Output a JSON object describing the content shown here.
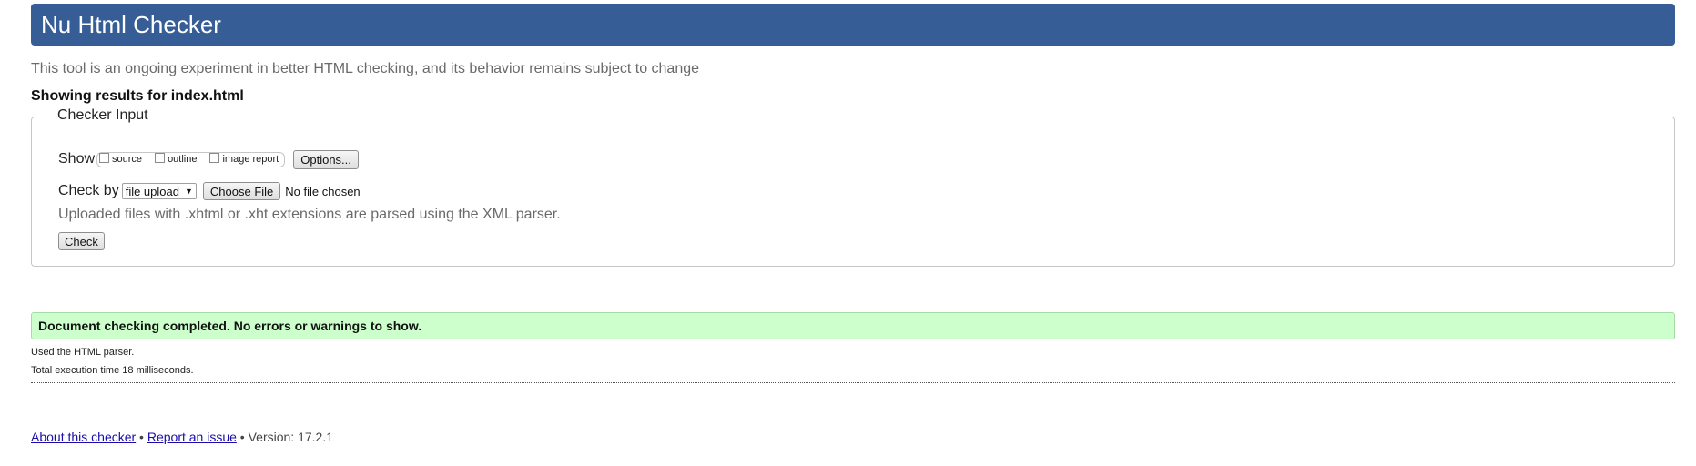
{
  "header": {
    "title": "Nu Html Checker"
  },
  "subtitle": "This tool is an ongoing experiment in better HTML checking, and its behavior remains subject to change",
  "showing_results": "Showing results for index.html",
  "checker_input": {
    "legend": "Checker Input",
    "show_label": "Show",
    "show_options": [
      {
        "label": "source",
        "checked": false
      },
      {
        "label": "outline",
        "checked": false
      },
      {
        "label": "image report",
        "checked": false
      }
    ],
    "options_button": "Options...",
    "check_by_label": "Check by",
    "check_by_select": "file upload",
    "choose_file_button": "Choose File",
    "no_file_text": "No file chosen",
    "xml_note": "Uploaded files with .xhtml or .xht extensions are parsed using the XML parser.",
    "check_button": "Check"
  },
  "result": {
    "message": "Document checking completed. No errors or warnings to show.",
    "parser_note": "Used the HTML parser.",
    "execution_time": "Total execution time 18 milliseconds."
  },
  "footer": {
    "about_link": "About this checker",
    "separator": " • ",
    "report_link": "Report an issue",
    "version": "Version: 17.2.1"
  },
  "colors": {
    "header_bg": "#365d95",
    "success_bg": "#ccffcc",
    "link": "#1a0dab"
  }
}
